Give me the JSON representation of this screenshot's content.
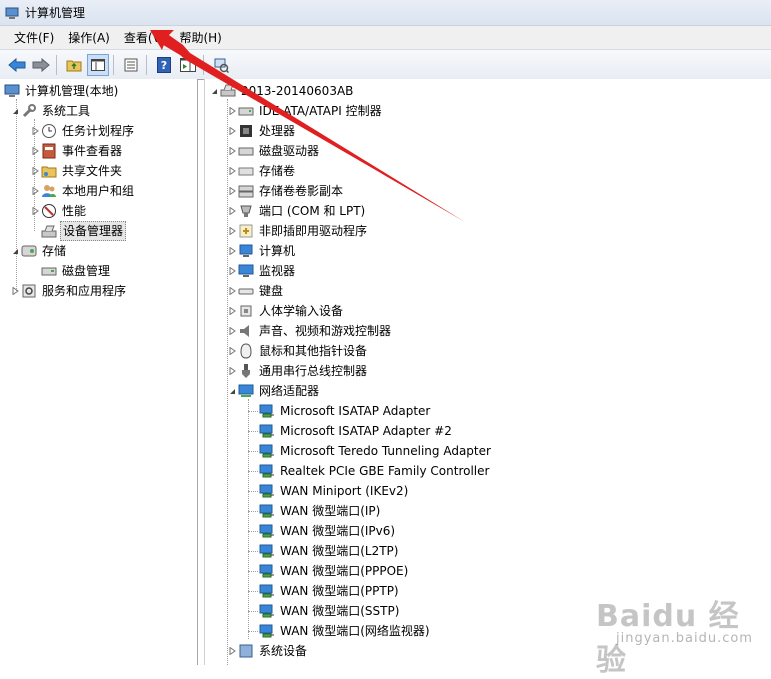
{
  "window": {
    "title": "计算机管理"
  },
  "menu": [
    "文件(F)",
    "操作(A)",
    "查看(V)",
    "帮助(H)"
  ],
  "left_tree": {
    "root": "计算机管理(本地)",
    "system_tools": "系统工具",
    "task_scheduler": "任务计划程序",
    "event_viewer": "事件查看器",
    "shared_folders": "共享文件夹",
    "local_users": "本地用户和组",
    "performance": "性能",
    "device_manager": "设备管理器",
    "storage": "存储",
    "disk_management": "磁盘管理",
    "services_apps": "服务和应用程序"
  },
  "right_tree": {
    "root": "2013-20140603AB",
    "categories": [
      "IDE ATA/ATAPI 控制器",
      "处理器",
      "磁盘驱动器",
      "存储卷",
      "存储卷卷影副本",
      "端口 (COM 和 LPT)",
      "非即插即用驱动程序",
      "计算机",
      "监视器",
      "键盘",
      "人体学输入设备",
      "声音、视频和游戏控制器",
      "鼠标和其他指针设备",
      "通用串行总线控制器",
      "网络适配器"
    ],
    "network_adapters": [
      "Microsoft ISATAP Adapter",
      "Microsoft ISATAP Adapter #2",
      "Microsoft Teredo Tunneling Adapter",
      "Realtek PCIe GBE Family Controller",
      "WAN Miniport (IKEv2)",
      "WAN 微型端口(IP)",
      "WAN 微型端口(IPv6)",
      "WAN 微型端口(L2TP)",
      "WAN 微型端口(PPPOE)",
      "WAN 微型端口(PPTP)",
      "WAN 微型端口(SSTP)",
      "WAN 微型端口(网络监视器)"
    ],
    "after": "系统设备"
  },
  "watermark": {
    "brand": "Baidu 经验",
    "url": "jingyan.baidu.com"
  },
  "colors": {
    "annotation_arrow": "#e02020",
    "selection": "#e6e6e6"
  }
}
